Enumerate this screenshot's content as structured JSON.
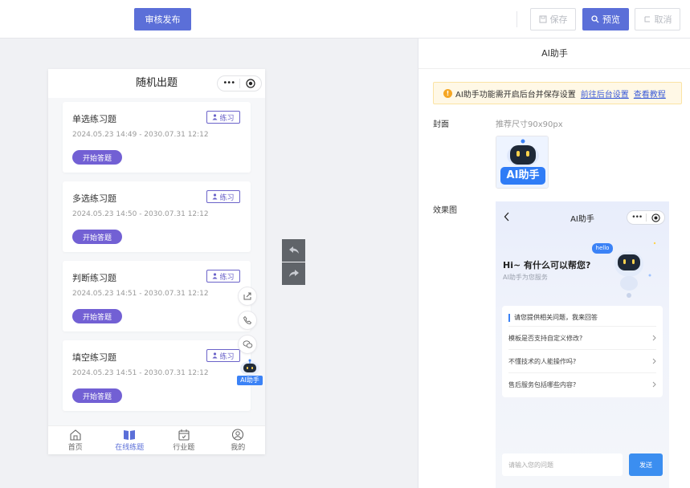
{
  "toolbar": {
    "publish_label": "审核发布",
    "save_label": "保存",
    "preview_label": "预览",
    "cancel_label": "取消"
  },
  "phone": {
    "title": "随机出题",
    "capsule_dots": "•••",
    "cards": [
      {
        "title": "单选练习题",
        "badge": "练习",
        "date": "2024.05.23 14:49 - 2030.07.31 12:12",
        "button": "开始答题"
      },
      {
        "title": "多选练习题",
        "badge": "练习",
        "date": "2024.05.23 14:50 - 2030.07.31 12:12",
        "button": "开始答题"
      },
      {
        "title": "判断练习题",
        "badge": "练习",
        "date": "2024.05.23 14:51 - 2030.07.31 12:12",
        "button": "开始答题"
      },
      {
        "title": "填空练习题",
        "badge": "练习",
        "date": "2024.05.23 14:51 - 2030.07.31 12:12",
        "button": "开始答题"
      }
    ],
    "ai_float_label": "AI助手",
    "tabs": [
      {
        "label": "首页",
        "icon": "home-icon"
      },
      {
        "label": "在线练题",
        "icon": "book-icon"
      },
      {
        "label": "行业题",
        "icon": "calendar-icon"
      },
      {
        "label": "我的",
        "icon": "user-icon"
      }
    ]
  },
  "panel": {
    "title": "AI助手",
    "notice_text": "AI助手功能需开启后台并保存设置",
    "notice_link1": "前往后台设置",
    "notice_link2": "查看教程",
    "cover_label": "封面",
    "cover_hint": "推荐尺寸90x90px",
    "cover_text": "AI助手",
    "effect_label": "效果图"
  },
  "preview": {
    "title": "AI助手",
    "capsule_dots": "•••",
    "greeting": "Hi~ 有什么可以帮您?",
    "subtitle": "AI助手为您服务",
    "bubble": "hello",
    "card_head": "请您提供相关问题，我来回答",
    "questions": [
      "模板是否支持自定义修改?",
      "不懂技术的人能操作吗?",
      "售后服务包括哪些内容?"
    ],
    "input_placeholder": "请输入您的问题",
    "send_label": "发送"
  },
  "colors": {
    "primary": "#5b6fd8",
    "practice_purple": "#7260d4",
    "ai_blue": "#3b82f6"
  }
}
